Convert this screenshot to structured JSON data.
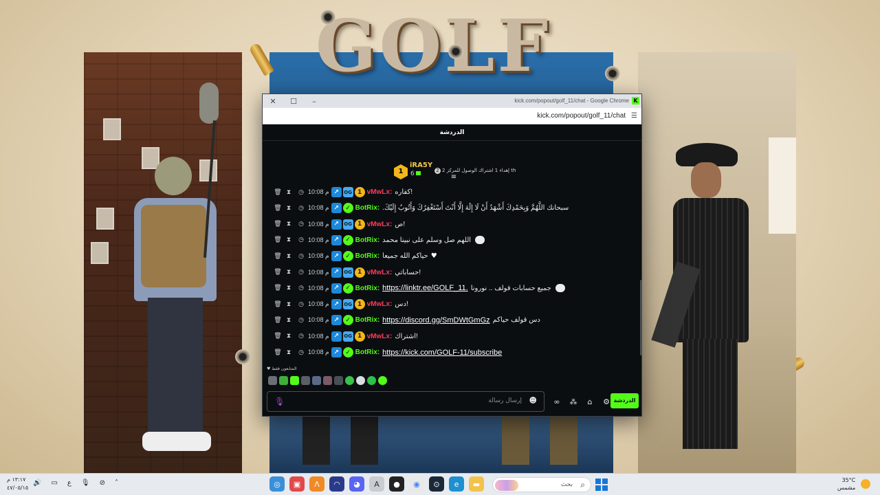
{
  "window": {
    "title": "kick.com/popout/golf_11/chat - Google Chrome",
    "url": "kick.com/popout/golf_11/chat",
    "favicon_letter": "K"
  },
  "wallpaper": {
    "title": "GOLF"
  },
  "chat": {
    "header_title": "الدردشة",
    "pinned_gift": {
      "username": "iRA5Y",
      "count": "6",
      "badge": "1",
      "description": "إهداء 1 اشتراك الوصول للمركز 2 th",
      "rank_icon": "2"
    },
    "messages": [
      {
        "time": "10:08 م",
        "badges": [
          "vip",
          "og",
          "sub"
        ],
        "user": "vMwLx:",
        "user_color": "red",
        "text": "كفاره!"
      },
      {
        "time": "10:08 م",
        "badges": [
          "vip",
          "bot"
        ],
        "user": "BotRix:",
        "user_color": "green",
        "text": ".سبحانك اللَّهُمَّ وَبِحَمْدِكَ أَشْهَدُ أَنْ لَا إِلَٰهَ إِلَّا أَنْتَ أَسْتَغْفِرُكَ وَأَتُوبُ إِلَيْكَ"
      },
      {
        "time": "10:08 م",
        "badges": [
          "vip",
          "og",
          "sub"
        ],
        "user": "vMwLx:",
        "user_color": "red",
        "text": "ص!"
      },
      {
        "time": "10:08 م",
        "badges": [
          "vip",
          "bot"
        ],
        "user": "BotRix:",
        "user_color": "green",
        "text": "اللهم صل وسلم على نبينا محمد",
        "emote": true
      },
      {
        "time": "10:08 م",
        "badges": [
          "vip",
          "bot"
        ],
        "user": "BotRix:",
        "user_color": "green",
        "text": "حياكم الله جميعا",
        "heart": true
      },
      {
        "time": "10:08 م",
        "badges": [
          "vip",
          "og",
          "sub"
        ],
        "user": "vMwLx:",
        "user_color": "red",
        "text": "حساباتي!"
      },
      {
        "time": "10:08 م",
        "badges": [
          "vip",
          "bot"
        ],
        "user": "BotRix:",
        "user_color": "green",
        "text": "جميع حسابات قولف .. نورونا",
        "link": "https://linktr.ee/GOLF_11.",
        "emote": true
      },
      {
        "time": "10:08 م",
        "badges": [
          "vip",
          "og",
          "sub"
        ],
        "user": "vMwLx:",
        "user_color": "red",
        "text": "دس!"
      },
      {
        "time": "10:08 م",
        "badges": [
          "vip",
          "bot"
        ],
        "user": "BotRix:",
        "user_color": "green",
        "text": "دس قولف حياكم",
        "link": "https://discord.gg/SmDWtGmGz"
      },
      {
        "time": "10:08 م",
        "badges": [
          "vip",
          "og",
          "sub"
        ],
        "user": "vMwLx:",
        "user_color": "red",
        "text": "اشتراك!"
      },
      {
        "time": "10:08 م",
        "badges": [
          "vip",
          "bot"
        ],
        "user": "BotRix:",
        "user_color": "green",
        "text": "",
        "link": "https://kick.com/GOLF-11/subscribe"
      }
    ],
    "followers_only_label": "المتابعون فقط",
    "input_placeholder": "إرسال رسالة",
    "chat_button_label": "الدردشة"
  },
  "taskbar": {
    "time": "١٣:١٧ م",
    "date": "٤٧/٠٥/١٥",
    "language": "ع",
    "search_placeholder": "بحث",
    "temperature": "35°C",
    "weather_text": "مشمس"
  },
  "colors": {
    "kick_green": "#53fc18",
    "username_red": "#ff3b5a",
    "chat_bg": "#0b0e11",
    "gift_gold": "#f2b71a"
  }
}
